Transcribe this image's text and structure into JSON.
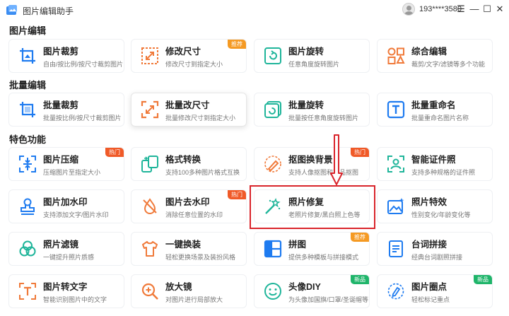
{
  "app": {
    "title": "图片编辑助手",
    "user": "193****3580"
  },
  "window_controls": {
    "menu": "☰",
    "minimize": "—",
    "maximize": "☐",
    "close": "✕"
  },
  "sections": [
    {
      "title": "图片编辑"
    },
    {
      "title": "批量编辑"
    },
    {
      "title": "特色功能"
    }
  ],
  "cards": [
    {
      "title": "图片裁剪",
      "desc": "自由/按比例/按尺寸裁剪图片",
      "icon": "crop-icon",
      "badge": ""
    },
    {
      "title": "修改尺寸",
      "desc": "修改尺寸到指定大小",
      "icon": "resize-icon",
      "badge": "推荐"
    },
    {
      "title": "图片旋转",
      "desc": "任意角度旋转图片",
      "icon": "rotate-icon",
      "badge": ""
    },
    {
      "title": "综合编辑",
      "desc": "裁剪/文字/滤镜等多个功能",
      "icon": "grid-edit-icon",
      "badge": ""
    },
    {
      "title": "批量裁剪",
      "desc": "批量按比例/按尺寸裁剪图片",
      "icon": "batch-crop-icon",
      "badge": ""
    },
    {
      "title": "批量改尺寸",
      "desc": "批量修改尺寸到指定大小",
      "icon": "batch-resize-icon",
      "badge": ""
    },
    {
      "title": "批量旋转",
      "desc": "批量按任意角度旋转图片",
      "icon": "batch-rotate-icon",
      "badge": ""
    },
    {
      "title": "批量重命名",
      "desc": "批量重命名图片名称",
      "icon": "rename-icon",
      "badge": ""
    },
    {
      "title": "图片压缩",
      "desc": "压缩图片至指定大小",
      "icon": "compress-icon",
      "badge": "热门"
    },
    {
      "title": "格式转换",
      "desc": "支持100多种图片格式互换",
      "icon": "convert-icon",
      "badge": ""
    },
    {
      "title": "抠图换背景",
      "desc": "支持人像抠图和商品抠图",
      "icon": "cutout-icon",
      "badge": "热门"
    },
    {
      "title": "智能证件照",
      "desc": "支持多种规格的证件照",
      "icon": "id-photo-icon",
      "badge": ""
    },
    {
      "title": "图片加水印",
      "desc": "支持添加文字/图片水印",
      "icon": "stamp-icon",
      "badge": ""
    },
    {
      "title": "图片去水印",
      "desc": "消除任意位置的水印",
      "icon": "remove-watermark-icon",
      "badge": "热门"
    },
    {
      "title": "照片修复",
      "desc": "老照片修复/黑白照上色等",
      "icon": "magic-wand-icon",
      "badge": ""
    },
    {
      "title": "照片特效",
      "desc": "性别变化/年龄变化等",
      "icon": "effect-icon",
      "badge": ""
    },
    {
      "title": "照片滤镜",
      "desc": "一键提升照片质感",
      "icon": "filter-icon",
      "badge": ""
    },
    {
      "title": "一键换装",
      "desc": "轻松更换场景及装扮风格",
      "icon": "clothes-icon",
      "badge": ""
    },
    {
      "title": "拼图",
      "desc": "提供多种模板与拼接模式",
      "icon": "collage-icon",
      "badge": "推荐"
    },
    {
      "title": "台词拼接",
      "desc": "经典台词剧照拼接",
      "icon": "subtitle-icon",
      "badge": ""
    },
    {
      "title": "图片转文字",
      "desc": "智能识别图片中的文字",
      "icon": "ocr-icon",
      "badge": ""
    },
    {
      "title": "放大镜",
      "desc": "对图片进行局部放大",
      "icon": "magnifier-icon",
      "badge": ""
    },
    {
      "title": "头像DIY",
      "desc": "为头像加国旗/口罩/圣诞帽等",
      "icon": "avatar-diy-icon",
      "badge": "新品"
    },
    {
      "title": "图片圈点",
      "desc": "轻松标记重点",
      "icon": "mark-icon",
      "badge": "新品"
    }
  ],
  "colors": {
    "accent_blue": "#1e7bf0",
    "accent_orange": "#f07a3a",
    "accent_green": "#1fb59a",
    "annotation_red": "#d9242b"
  }
}
